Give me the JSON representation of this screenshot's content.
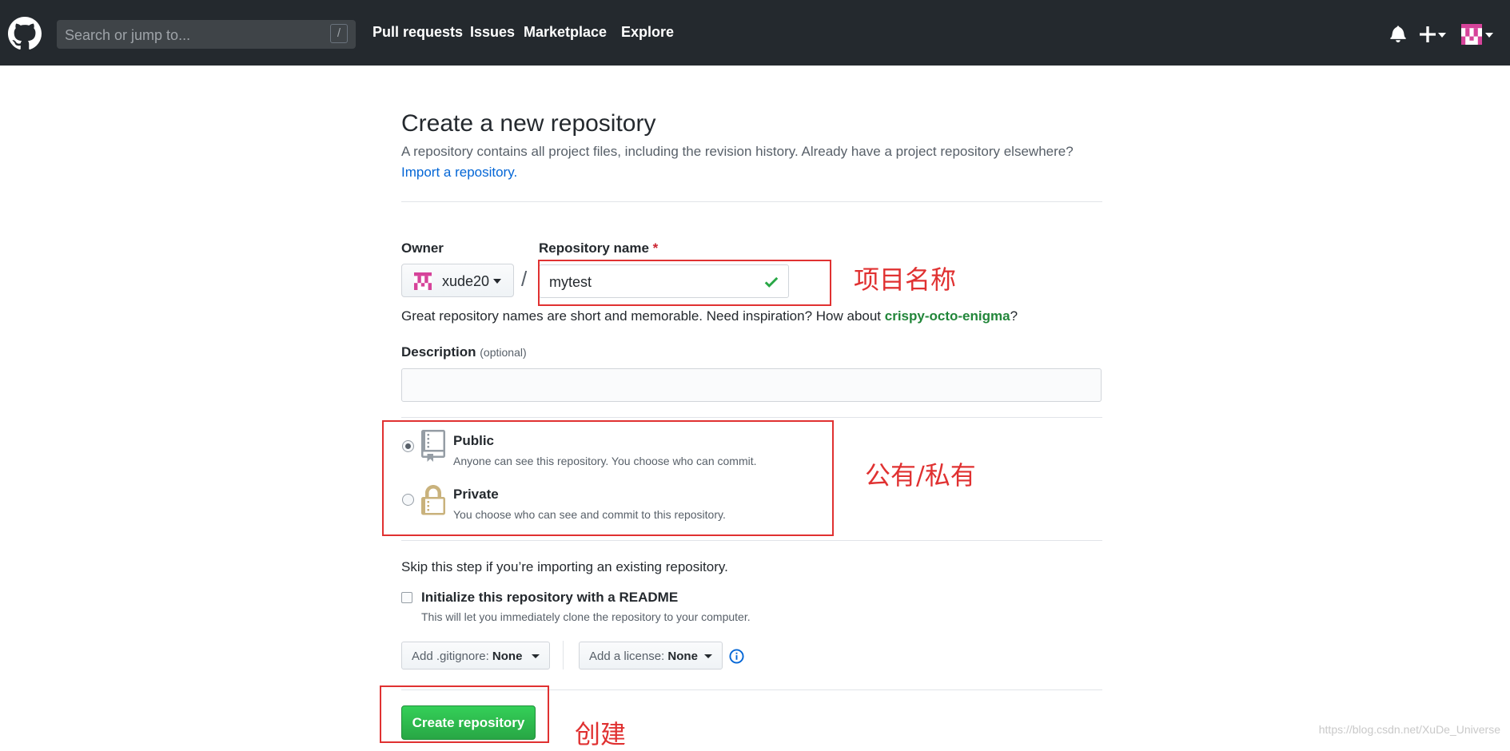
{
  "header": {
    "search_placeholder": "Search or jump to...",
    "search_shortcut": "/",
    "nav": [
      "Pull requests",
      "Issues",
      "Marketplace",
      "Explore"
    ]
  },
  "page": {
    "title": "Create a new repository",
    "lead": "A repository contains all project files, including the revision history. Already have a project repository elsewhere?",
    "import_link": "Import a repository."
  },
  "form": {
    "owner_label": "Owner",
    "owner_value": "xude20",
    "repo_name_label": "Repository name",
    "required_marker": "*",
    "repo_name_value": "mytest",
    "hint_prefix": "Great repository names are short and memorable. Need inspiration? How about ",
    "hint_suggestion": "crispy-octo-enigma",
    "hint_suffix": "?",
    "description_label": "Description",
    "description_optional": "(optional)",
    "description_value": ""
  },
  "visibility": {
    "selected": "public",
    "public_title": "Public",
    "public_desc": "Anyone can see this repository. You choose who can commit.",
    "private_title": "Private",
    "private_desc": "You choose who can see and commit to this repository."
  },
  "init": {
    "skip_text": "Skip this step if you’re importing an existing repository.",
    "readme_label": "Initialize this repository with a README",
    "readme_checked": false,
    "readme_desc": "This will let you immediately clone the repository to your computer.",
    "gitignore_prefix": "Add .gitignore:",
    "gitignore_value": "None",
    "license_prefix": "Add a license:",
    "license_value": "None"
  },
  "create_button": "Create repository",
  "annotations": {
    "name": "项目名称",
    "visibility": "公有/私有",
    "create": "创建"
  },
  "watermark": "https://blog.csdn.net/XuDe_Universe",
  "colors": {
    "header_bg": "#24292e",
    "link": "#0366d6",
    "success": "#28a745",
    "annotation": "#e03131"
  }
}
